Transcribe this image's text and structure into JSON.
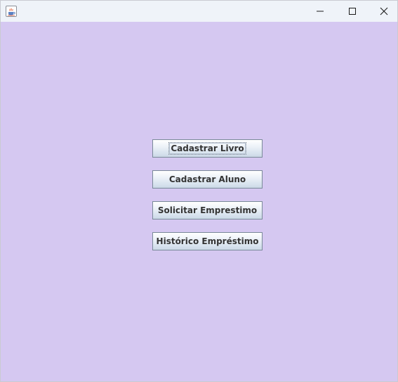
{
  "window": {
    "icon": "java-coffee-icon",
    "controls": {
      "minimize": "minimize-icon",
      "maximize": "maximize-icon",
      "close": "close-icon"
    }
  },
  "colors": {
    "background": "#d5c8f1",
    "titlebar": "#eff3f9",
    "button_border": "#7a8a99",
    "button_text": "#333333"
  },
  "menu": {
    "buttons": [
      {
        "label": "Cadastrar Livro"
      },
      {
        "label": "Cadastrar Aluno"
      },
      {
        "label": "Solicitar Emprestimo"
      },
      {
        "label": "Histórico Empréstimo"
      }
    ]
  }
}
